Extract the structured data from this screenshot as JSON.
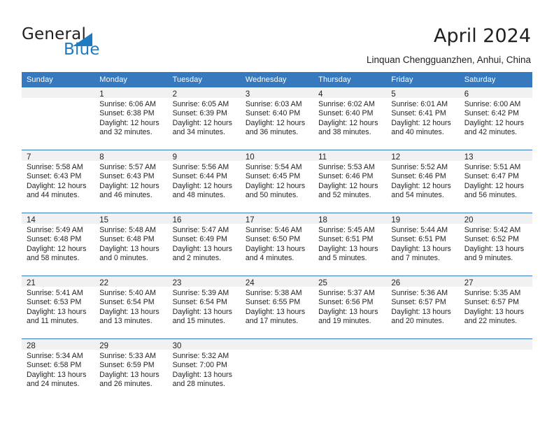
{
  "brand": {
    "name_part1": "General",
    "name_part2": "Blue",
    "logo_icon": "triangle-flag-icon",
    "accent_color": "#1f7bc1"
  },
  "header": {
    "title": "April 2024",
    "location": "Linquan Chengguanzhen, Anhui, China"
  },
  "theme": {
    "header_blue": "#3679bf",
    "daynum_bg": "#f1f1f1",
    "text": "#231f20"
  },
  "calendar": {
    "weekday_headers": [
      "Sunday",
      "Monday",
      "Tuesday",
      "Wednesday",
      "Thursday",
      "Friday",
      "Saturday"
    ],
    "labels": {
      "sunrise": "Sunrise:",
      "sunset": "Sunset:",
      "daylight": "Daylight:"
    },
    "weeks": [
      [
        {
          "day": "",
          "empty": true,
          "sunrise": "",
          "sunset": "",
          "daylight_line1": "",
          "daylight_line2": ""
        },
        {
          "day": "1",
          "empty": false,
          "sunrise": "Sunrise: 6:06 AM",
          "sunset": "Sunset: 6:38 PM",
          "daylight_line1": "Daylight: 12 hours",
          "daylight_line2": "and 32 minutes."
        },
        {
          "day": "2",
          "empty": false,
          "sunrise": "Sunrise: 6:05 AM",
          "sunset": "Sunset: 6:39 PM",
          "daylight_line1": "Daylight: 12 hours",
          "daylight_line2": "and 34 minutes."
        },
        {
          "day": "3",
          "empty": false,
          "sunrise": "Sunrise: 6:03 AM",
          "sunset": "Sunset: 6:40 PM",
          "daylight_line1": "Daylight: 12 hours",
          "daylight_line2": "and 36 minutes."
        },
        {
          "day": "4",
          "empty": false,
          "sunrise": "Sunrise: 6:02 AM",
          "sunset": "Sunset: 6:40 PM",
          "daylight_line1": "Daylight: 12 hours",
          "daylight_line2": "and 38 minutes."
        },
        {
          "day": "5",
          "empty": false,
          "sunrise": "Sunrise: 6:01 AM",
          "sunset": "Sunset: 6:41 PM",
          "daylight_line1": "Daylight: 12 hours",
          "daylight_line2": "and 40 minutes."
        },
        {
          "day": "6",
          "empty": false,
          "sunrise": "Sunrise: 6:00 AM",
          "sunset": "Sunset: 6:42 PM",
          "daylight_line1": "Daylight: 12 hours",
          "daylight_line2": "and 42 minutes."
        }
      ],
      [
        {
          "day": "7",
          "empty": false,
          "sunrise": "Sunrise: 5:58 AM",
          "sunset": "Sunset: 6:43 PM",
          "daylight_line1": "Daylight: 12 hours",
          "daylight_line2": "and 44 minutes."
        },
        {
          "day": "8",
          "empty": false,
          "sunrise": "Sunrise: 5:57 AM",
          "sunset": "Sunset: 6:43 PM",
          "daylight_line1": "Daylight: 12 hours",
          "daylight_line2": "and 46 minutes."
        },
        {
          "day": "9",
          "empty": false,
          "sunrise": "Sunrise: 5:56 AM",
          "sunset": "Sunset: 6:44 PM",
          "daylight_line1": "Daylight: 12 hours",
          "daylight_line2": "and 48 minutes."
        },
        {
          "day": "10",
          "empty": false,
          "sunrise": "Sunrise: 5:54 AM",
          "sunset": "Sunset: 6:45 PM",
          "daylight_line1": "Daylight: 12 hours",
          "daylight_line2": "and 50 minutes."
        },
        {
          "day": "11",
          "empty": false,
          "sunrise": "Sunrise: 5:53 AM",
          "sunset": "Sunset: 6:46 PM",
          "daylight_line1": "Daylight: 12 hours",
          "daylight_line2": "and 52 minutes."
        },
        {
          "day": "12",
          "empty": false,
          "sunrise": "Sunrise: 5:52 AM",
          "sunset": "Sunset: 6:46 PM",
          "daylight_line1": "Daylight: 12 hours",
          "daylight_line2": "and 54 minutes."
        },
        {
          "day": "13",
          "empty": false,
          "sunrise": "Sunrise: 5:51 AM",
          "sunset": "Sunset: 6:47 PM",
          "daylight_line1": "Daylight: 12 hours",
          "daylight_line2": "and 56 minutes."
        }
      ],
      [
        {
          "day": "14",
          "empty": false,
          "sunrise": "Sunrise: 5:49 AM",
          "sunset": "Sunset: 6:48 PM",
          "daylight_line1": "Daylight: 12 hours",
          "daylight_line2": "and 58 minutes."
        },
        {
          "day": "15",
          "empty": false,
          "sunrise": "Sunrise: 5:48 AM",
          "sunset": "Sunset: 6:48 PM",
          "daylight_line1": "Daylight: 13 hours",
          "daylight_line2": "and 0 minutes."
        },
        {
          "day": "16",
          "empty": false,
          "sunrise": "Sunrise: 5:47 AM",
          "sunset": "Sunset: 6:49 PM",
          "daylight_line1": "Daylight: 13 hours",
          "daylight_line2": "and 2 minutes."
        },
        {
          "day": "17",
          "empty": false,
          "sunrise": "Sunrise: 5:46 AM",
          "sunset": "Sunset: 6:50 PM",
          "daylight_line1": "Daylight: 13 hours",
          "daylight_line2": "and 4 minutes."
        },
        {
          "day": "18",
          "empty": false,
          "sunrise": "Sunrise: 5:45 AM",
          "sunset": "Sunset: 6:51 PM",
          "daylight_line1": "Daylight: 13 hours",
          "daylight_line2": "and 5 minutes."
        },
        {
          "day": "19",
          "empty": false,
          "sunrise": "Sunrise: 5:44 AM",
          "sunset": "Sunset: 6:51 PM",
          "daylight_line1": "Daylight: 13 hours",
          "daylight_line2": "and 7 minutes."
        },
        {
          "day": "20",
          "empty": false,
          "sunrise": "Sunrise: 5:42 AM",
          "sunset": "Sunset: 6:52 PM",
          "daylight_line1": "Daylight: 13 hours",
          "daylight_line2": "and 9 minutes."
        }
      ],
      [
        {
          "day": "21",
          "empty": false,
          "sunrise": "Sunrise: 5:41 AM",
          "sunset": "Sunset: 6:53 PM",
          "daylight_line1": "Daylight: 13 hours",
          "daylight_line2": "and 11 minutes."
        },
        {
          "day": "22",
          "empty": false,
          "sunrise": "Sunrise: 5:40 AM",
          "sunset": "Sunset: 6:54 PM",
          "daylight_line1": "Daylight: 13 hours",
          "daylight_line2": "and 13 minutes."
        },
        {
          "day": "23",
          "empty": false,
          "sunrise": "Sunrise: 5:39 AM",
          "sunset": "Sunset: 6:54 PM",
          "daylight_line1": "Daylight: 13 hours",
          "daylight_line2": "and 15 minutes."
        },
        {
          "day": "24",
          "empty": false,
          "sunrise": "Sunrise: 5:38 AM",
          "sunset": "Sunset: 6:55 PM",
          "daylight_line1": "Daylight: 13 hours",
          "daylight_line2": "and 17 minutes."
        },
        {
          "day": "25",
          "empty": false,
          "sunrise": "Sunrise: 5:37 AM",
          "sunset": "Sunset: 6:56 PM",
          "daylight_line1": "Daylight: 13 hours",
          "daylight_line2": "and 19 minutes."
        },
        {
          "day": "26",
          "empty": false,
          "sunrise": "Sunrise: 5:36 AM",
          "sunset": "Sunset: 6:57 PM",
          "daylight_line1": "Daylight: 13 hours",
          "daylight_line2": "and 20 minutes."
        },
        {
          "day": "27",
          "empty": false,
          "sunrise": "Sunrise: 5:35 AM",
          "sunset": "Sunset: 6:57 PM",
          "daylight_line1": "Daylight: 13 hours",
          "daylight_line2": "and 22 minutes."
        }
      ],
      [
        {
          "day": "28",
          "empty": false,
          "sunrise": "Sunrise: 5:34 AM",
          "sunset": "Sunset: 6:58 PM",
          "daylight_line1": "Daylight: 13 hours",
          "daylight_line2": "and 24 minutes."
        },
        {
          "day": "29",
          "empty": false,
          "sunrise": "Sunrise: 5:33 AM",
          "sunset": "Sunset: 6:59 PM",
          "daylight_line1": "Daylight: 13 hours",
          "daylight_line2": "and 26 minutes."
        },
        {
          "day": "30",
          "empty": false,
          "sunrise": "Sunrise: 5:32 AM",
          "sunset": "Sunset: 7:00 PM",
          "daylight_line1": "Daylight: 13 hours",
          "daylight_line2": "and 28 minutes."
        },
        {
          "day": "",
          "empty": true,
          "sunrise": "",
          "sunset": "",
          "daylight_line1": "",
          "daylight_line2": ""
        },
        {
          "day": "",
          "empty": true,
          "sunrise": "",
          "sunset": "",
          "daylight_line1": "",
          "daylight_line2": ""
        },
        {
          "day": "",
          "empty": true,
          "sunrise": "",
          "sunset": "",
          "daylight_line1": "",
          "daylight_line2": ""
        },
        {
          "day": "",
          "empty": true,
          "sunrise": "",
          "sunset": "",
          "daylight_line1": "",
          "daylight_line2": ""
        }
      ]
    ]
  }
}
